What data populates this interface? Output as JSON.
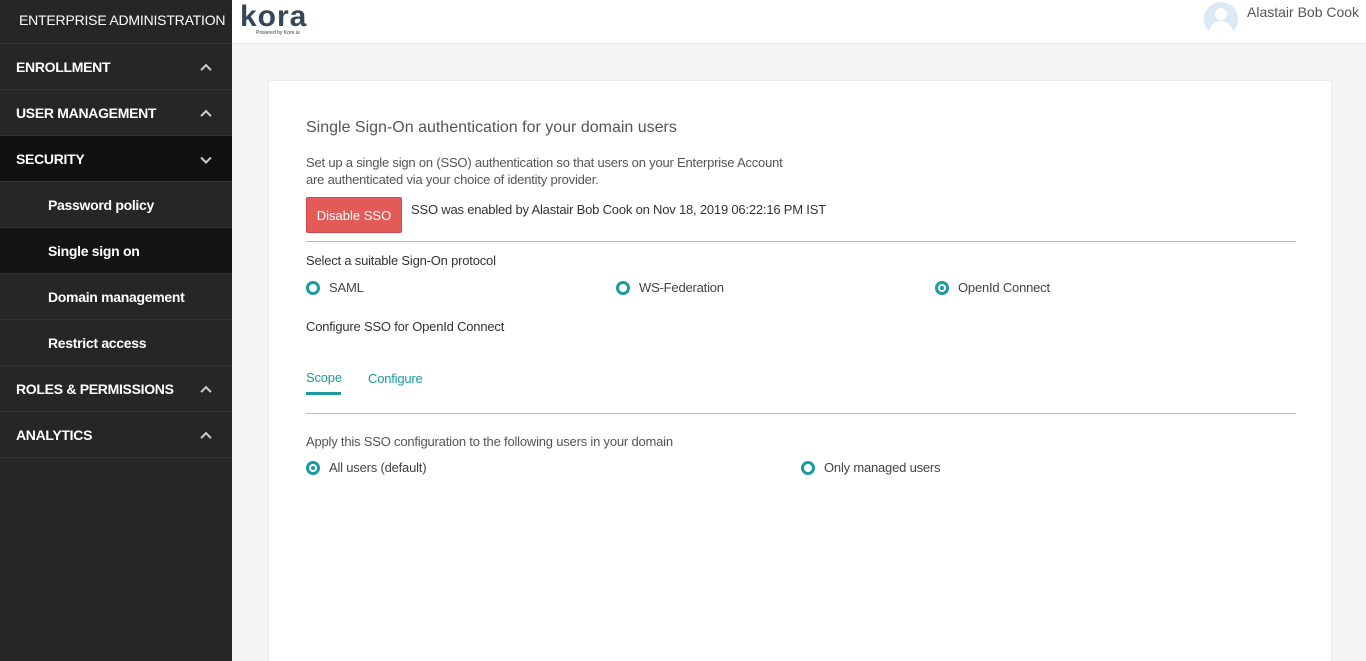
{
  "sidebar": {
    "header": "ENTERPRISE ADMINISTRATION",
    "sections": [
      {
        "label": "ENROLLMENT",
        "state": "collapsed"
      },
      {
        "label": "USER MANAGEMENT",
        "state": "collapsed"
      },
      {
        "label": "SECURITY",
        "state": "expanded"
      },
      {
        "label": "ROLES & PERMISSIONS",
        "state": "collapsed"
      },
      {
        "label": "ANALYTICS",
        "state": "collapsed"
      }
    ],
    "security_items": [
      {
        "label": "Password policy"
      },
      {
        "label": "Single sign on",
        "active": true
      },
      {
        "label": "Domain management"
      },
      {
        "label": "Restrict access"
      }
    ]
  },
  "topbar": {
    "logo_text": "kora",
    "logo_sub": "Powered by Kore.ai",
    "user_name": "Alastair Bob Cook"
  },
  "main": {
    "title": "Single Sign-On authentication for your domain users",
    "description_line1": "Set up a single sign on (SSO) authentication so that users on your Enterprise Account",
    "description_line2": "are authenticated via your choice of identity provider.",
    "disable_button": "Disable SSO",
    "sso_status": "SSO was enabled by Alastair Bob Cook on Nov 18, 2019 06:22:16 PM IST",
    "protocol_label": "Select a suitable Sign-On protocol",
    "protocols": [
      {
        "label": "SAML",
        "checked": false
      },
      {
        "label": "WS-Federation",
        "checked": false
      },
      {
        "label": "OpenId Connect",
        "checked": true
      }
    ],
    "configure_label": "Configure SSO for OpenId Connect",
    "tabs": [
      {
        "label": "Scope",
        "active": true
      },
      {
        "label": "Configure",
        "active": false
      }
    ],
    "scope_label": "Apply this SSO configuration to the following users in your domain",
    "scope_options": [
      {
        "label": "All users (default)",
        "checked": true
      },
      {
        "label": "Only managed users",
        "checked": false
      }
    ]
  },
  "colors": {
    "accent": "#1c9aa4",
    "danger": "#e25b58",
    "sidebar_bg": "#262626"
  }
}
